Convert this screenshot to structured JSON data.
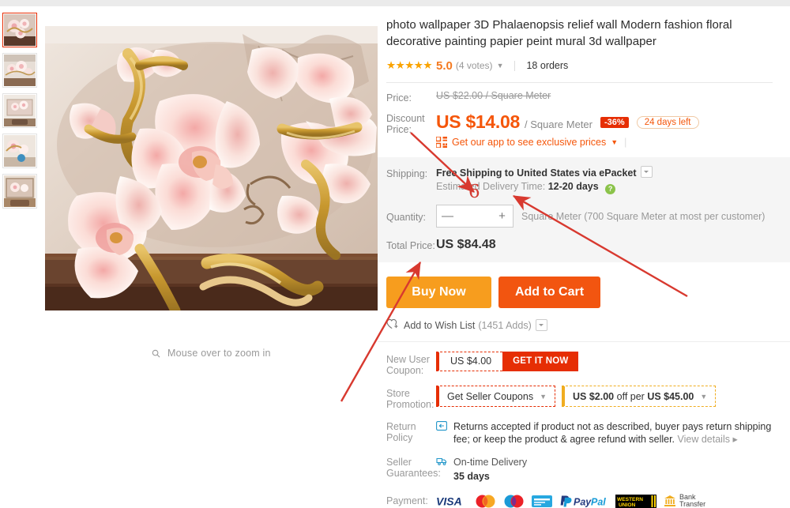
{
  "gallery": {
    "zoom_hint": "Mouse over to zoom in",
    "zoom_icon": "magnifier-icon",
    "thumbnails": [
      {
        "name": "thumbnail-1",
        "selected": true
      },
      {
        "name": "thumbnail-2",
        "selected": false
      },
      {
        "name": "thumbnail-3",
        "selected": false
      },
      {
        "name": "thumbnail-4",
        "selected": false
      },
      {
        "name": "thumbnail-5",
        "selected": false
      }
    ],
    "main_image_alt": "3D relief orchid flower mural wallpaper"
  },
  "product": {
    "title": "photo wallpaper 3D Phalaenopsis relief wall Modern fashion floral decorative painting papier peint mural 3d wallpaper",
    "stars": "★★★★★",
    "score": "5.0",
    "votes": "(4 votes)",
    "rating_caret": "▼",
    "orders": "18 orders"
  },
  "price": {
    "price_label": "Price:",
    "original": "US $22.00 / Square Meter",
    "discount_label": "Discount Price:",
    "discount_value": "US $14.08",
    "unit": "/ Square Meter",
    "discount_badge": "-36%",
    "days_left": "24 days left",
    "app_text": "Get our app to see exclusive prices",
    "app_caret": "▼",
    "qr_icon": "qr-code-icon"
  },
  "shipping": {
    "label": "Shipping:",
    "method": "Free Shipping to United States via ePacket",
    "delivery_prefix": "Estimated Delivery Time:",
    "delivery_time": "12-20",
    "delivery_suffix": "days",
    "help_icon": "question-mark-icon"
  },
  "quantity": {
    "label": "Quantity:",
    "minus": "—",
    "plus": "+",
    "value": "",
    "note": "Square Meter (700 Square Meter at most per customer)"
  },
  "total": {
    "label": "Total Price:",
    "value": "US $84.48"
  },
  "actions": {
    "buy_now": "Buy Now",
    "add_to_cart": "Add to Cart",
    "wish_icon": "heart-plus-icon",
    "wish_label": "Add to Wish List",
    "wish_count": "(1451 Adds)"
  },
  "coupons": {
    "new_user_label": "New User Coupon:",
    "new_user_amount": "US $4.00",
    "new_user_cta": "GET IT NOW",
    "store_label": "Store Promotion:",
    "seller_coupons": "Get Seller Coupons",
    "seller_caret": "▼",
    "promo_off": "US $2.00",
    "promo_off_mid": " off per ",
    "promo_off_amt": "US $45.00",
    "promo_caret": "▼"
  },
  "policy": {
    "return_label": "Return Policy",
    "return_icon": "return-box-icon",
    "return_text": "Returns accepted if product not as described, buyer pays return shipping fee; or keep the product & agree refund with seller.",
    "view_details": "View details ▸",
    "guarantee_label": "Seller Guarantees:",
    "guarantee_icon": "delivery-truck-icon",
    "guarantee_title": "On-time Delivery",
    "guarantee_days": "35 days"
  },
  "payment": {
    "label": "Payment:",
    "methods": [
      {
        "name": "visa-logo",
        "text": "VISA"
      },
      {
        "name": "mastercard-logo",
        "text": ""
      },
      {
        "name": "maestro-logo",
        "text": ""
      },
      {
        "name": "card-logo",
        "text": ""
      },
      {
        "name": "paypal-logo",
        "text": "PayPal"
      },
      {
        "name": "western-union-logo",
        "text": "WESTERN UNION"
      },
      {
        "name": "bank-transfer-logo",
        "text": "Bank Transfer"
      }
    ],
    "bank_line1": "Bank",
    "bank_line2": "Transfer"
  },
  "annotations": {
    "handwritten_quantity": "6",
    "arrow_color": "#d8392f"
  },
  "colors": {
    "accent_orange": "#f5560a",
    "buy_now": "#f79d1e",
    "add_to_cart": "#f25510",
    "coupon_red": "#e62e04",
    "promo_yellow": "#f0ad20",
    "star": "#faa300"
  }
}
